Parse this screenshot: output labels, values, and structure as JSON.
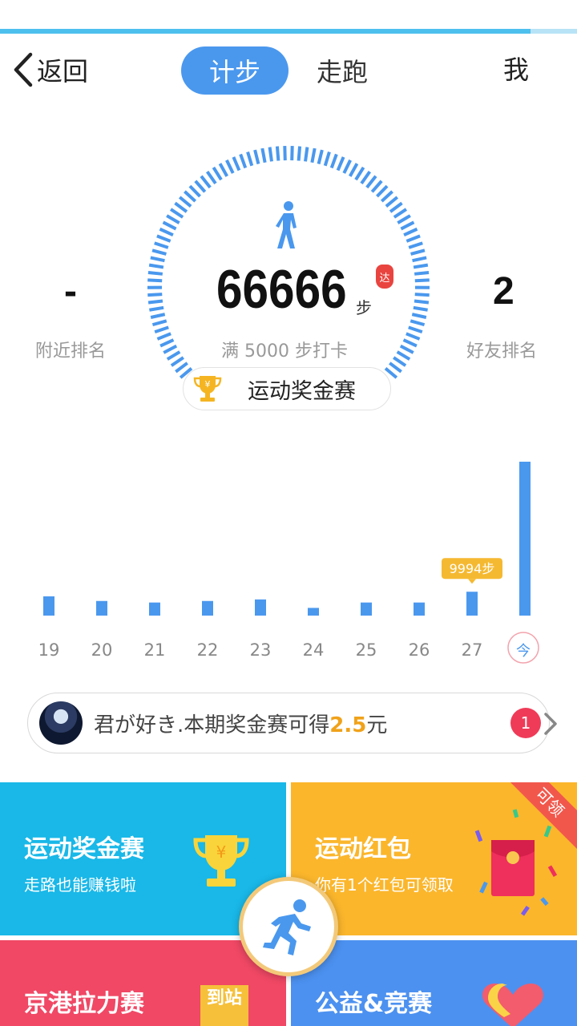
{
  "header": {
    "back_label": "返回",
    "tabs": [
      {
        "label": "计步"
      },
      {
        "label": "走跑"
      }
    ],
    "me_label": "我",
    "progress_fraction": 0.92
  },
  "summary": {
    "steps": "66666",
    "steps_unit": "步",
    "stamp_text": "达",
    "goal_text": "满 5000 步打卡",
    "nearby_rank_value": "-",
    "nearby_rank_label": "附近排名",
    "friend_rank_value": "2",
    "friend_rank_label": "好友排名",
    "contest_button": "运动奖金赛"
  },
  "chart_data": {
    "type": "bar",
    "categories": [
      "19",
      "20",
      "21",
      "22",
      "23",
      "24",
      "25",
      "26",
      "27",
      "今"
    ],
    "values": [
      1250,
      950,
      850,
      950,
      1050,
      500,
      850,
      850,
      1550,
      9994
    ],
    "tooltip": {
      "index": 8,
      "label": "9994步"
    },
    "highlight_index": 9
  },
  "notice": {
    "prefix": "君が好き.本期奖金赛可得",
    "amount": "2.5",
    "suffix": "元",
    "unread_count": "1"
  },
  "cards": [
    {
      "title": "运动奖金赛",
      "subtitle": "走路也能赚钱啦",
      "color": "#19b8e8",
      "icon": "trophy-icon"
    },
    {
      "title": "运动红包",
      "subtitle": "你有1个红包可领取",
      "color": "#fbb62c",
      "icon": "red-envelope-icon",
      "ribbon": "可领"
    },
    {
      "title": "京港拉力赛",
      "subtitle": "",
      "color": "#f04865",
      "icon": "station-tag-icon",
      "tag": "到站"
    },
    {
      "title": "公益&竞赛",
      "subtitle": "",
      "color": "#4c91f0",
      "icon": "heart-icon"
    }
  ],
  "colors": {
    "accent": "#4a98ee",
    "gauge": "#4a98ee",
    "bar": "#4a98ee",
    "tooltip": "#f5b931"
  }
}
